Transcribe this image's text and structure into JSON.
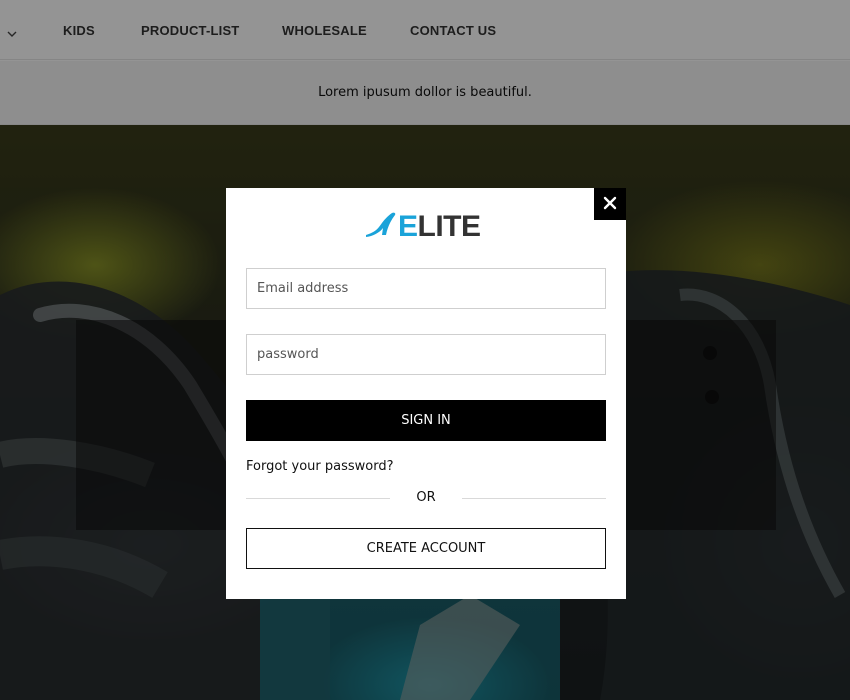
{
  "nav": {
    "caret_icon": "chevron-down-icon",
    "items": [
      {
        "label": "KIDS"
      },
      {
        "label": "PRODUCT-LIST"
      },
      {
        "label": "WHOLESALE"
      },
      {
        "label": "CONTACT US"
      }
    ]
  },
  "promo": {
    "text": "Lorem ipusum dollor is beautiful."
  },
  "modal": {
    "close_icon": "close-icon",
    "logo": {
      "icon": "high-heel-icon",
      "text_accent": "E",
      "text_rest": "LITE"
    },
    "email_placeholder": "Email address",
    "password_placeholder": "password",
    "signin_label": "SIGN IN",
    "forgot_label": "Forgot your password?",
    "or_label": "OR",
    "create_label": "CREATE ACCOUNT"
  },
  "colors": {
    "brand_accent": "#1aa3d9",
    "primary_button": "#000000",
    "overlay": "rgba(0,0,0,0.42)"
  }
}
